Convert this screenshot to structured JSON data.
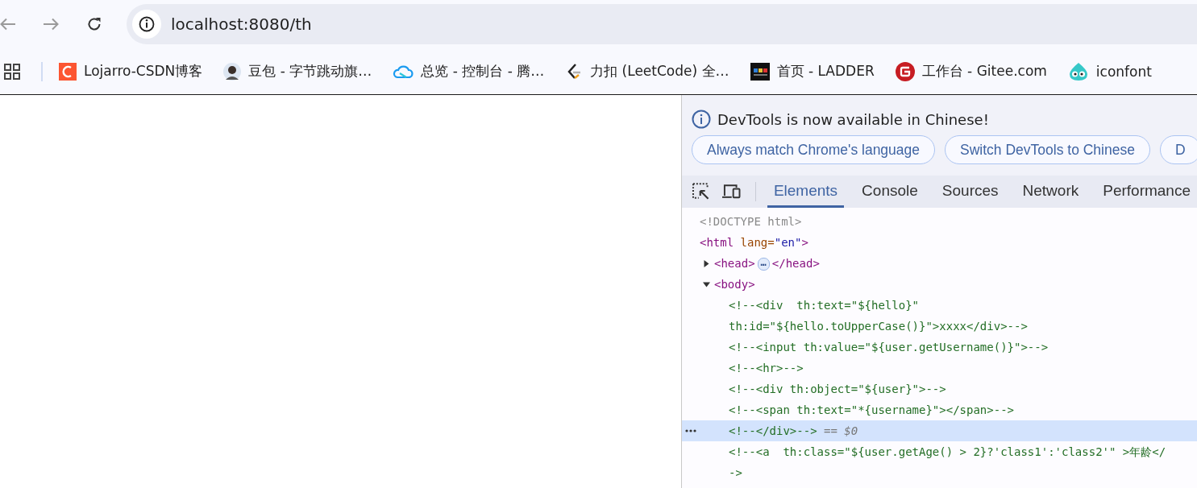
{
  "toolbar": {
    "back_disabled": true,
    "forward_disabled": true,
    "url": "localhost:8080/th"
  },
  "bookmarks": [
    {
      "kind": "csdn",
      "label": "Lojarro-CSDN博客"
    },
    {
      "kind": "avatar",
      "label": "豆包 - 字节跳动旗…"
    },
    {
      "kind": "cloud",
      "label": "总览 - 控制台 - 腾…"
    },
    {
      "kind": "leetcode",
      "label": "力扣 (LeetCode) 全…"
    },
    {
      "kind": "ladder",
      "label": "首页 - LADDER"
    },
    {
      "kind": "gitee",
      "label": "工作台 - Gitee.com"
    },
    {
      "kind": "iconfont",
      "label": "iconfont"
    }
  ],
  "devtools": {
    "infobar": {
      "message": "DevTools is now available in Chinese!",
      "buttons": [
        "Always match Chrome's language",
        "Switch DevTools to Chinese",
        "D"
      ]
    },
    "tabs": [
      {
        "label": "Elements",
        "selected": true
      },
      {
        "label": "Console",
        "selected": false
      },
      {
        "label": "Sources",
        "selected": false
      },
      {
        "label": "Network",
        "selected": false
      },
      {
        "label": "Performance",
        "selected": false
      }
    ],
    "dom_tree": [
      {
        "selected": false,
        "segments": [
          {
            "kind": "doctype",
            "text": "<!DOCTYPE html>"
          }
        ]
      },
      {
        "selected": false,
        "segments": [
          {
            "kind": "tag",
            "text": "<html "
          },
          {
            "kind": "attr-name",
            "text": "lang="
          },
          {
            "kind": "attr-value",
            "text": "\"en\""
          },
          {
            "kind": "tag",
            "text": ">"
          }
        ],
        "children": [
          {
            "selected": false,
            "expanded": false,
            "segments": [
              {
                "kind": "tag",
                "text": "<head>"
              },
              {
                "kind": "badge",
                "text": "…"
              },
              {
                "kind": "tag",
                "text": "</head>"
              }
            ]
          },
          {
            "selected": false,
            "expanded": true,
            "segments": [
              {
                "kind": "tag",
                "text": "<body>"
              }
            ],
            "children": [
              {
                "selected": false,
                "segments": [
                  {
                    "kind": "comment",
                    "text": "<!--<div  th:text=\"${hello}\"\nth:id=\"${hello.toUpperCase()}\">xxxx</div>-->"
                  }
                ]
              },
              {
                "selected": false,
                "segments": [
                  {
                    "kind": "comment",
                    "text": "<!--<input th:value=\"${user.getUsername()}\">-->"
                  }
                ]
              },
              {
                "selected": false,
                "segments": [
                  {
                    "kind": "comment",
                    "text": "<!--<hr>-->"
                  }
                ]
              },
              {
                "selected": false,
                "segments": [
                  {
                    "kind": "comment",
                    "text": "<!--<div th:object=\"${user}\">-->"
                  }
                ]
              },
              {
                "selected": false,
                "segments": [
                  {
                    "kind": "comment",
                    "text": "<!--<span th:text=\"*{username}\"></span>-->"
                  }
                ]
              },
              {
                "selected": true,
                "segments": [
                  {
                    "kind": "comment",
                    "text": "<!--</div>-->"
                  },
                  {
                    "kind": "ref",
                    "text": " == $0"
                  }
                ]
              },
              {
                "selected": false,
                "segments": [
                  {
                    "kind": "comment",
                    "text": "<!--<a  th:class=\"${user.getAge() > 2}?'class1':'class2'\" >年龄</\n->"
                  }
                ]
              }
            ]
          }
        ]
      }
    ]
  }
}
